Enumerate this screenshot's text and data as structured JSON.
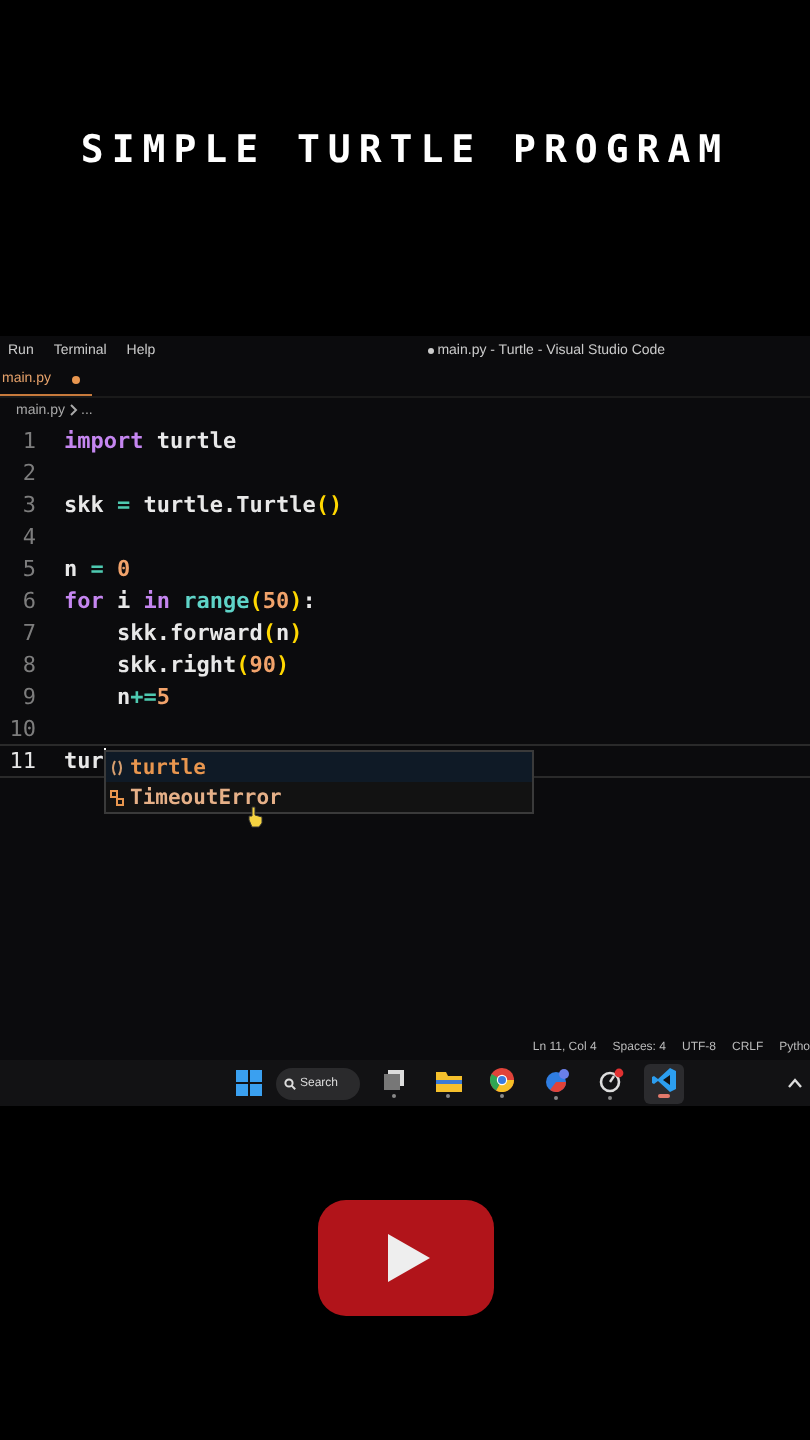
{
  "heading": "SIMPLE TURTLE PROGRAM",
  "window": {
    "menu": [
      "Run",
      "Terminal",
      "Help"
    ],
    "title": "main.py - Turtle - Visual Studio Code",
    "modified": true
  },
  "tabs": [
    {
      "label": "main.py",
      "selected": true,
      "modified": true
    }
  ],
  "breadcrumbs": [
    "main.py",
    "..."
  ],
  "editor": {
    "lines": [
      {
        "number": "1",
        "current": false,
        "tokens": [
          {
            "text": "import",
            "kind": "keyword"
          },
          {
            "text": " turtle",
            "kind": "plain"
          }
        ]
      },
      {
        "number": "2",
        "current": false
      },
      {
        "number": "3",
        "current": false,
        "tokens": [
          {
            "text": "skk ",
            "kind": "plain"
          },
          {
            "text": "=",
            "kind": "operator"
          },
          {
            "text": " turtle.Turtle",
            "kind": "plain"
          },
          {
            "text": "()",
            "kind": "paren"
          }
        ]
      },
      {
        "number": "4",
        "current": false
      },
      {
        "number": "5",
        "current": false,
        "tokens": [
          {
            "text": "n ",
            "kind": "plain"
          },
          {
            "text": "=",
            "kind": "operator"
          },
          {
            "text": " 0",
            "kind": "number"
          }
        ]
      },
      {
        "number": "6",
        "current": false,
        "tokens": [
          {
            "text": "for",
            "kind": "keyword"
          },
          {
            "text": " i ",
            "kind": "plain"
          },
          {
            "text": "in ",
            "kind": "keyword"
          },
          {
            "text": "range",
            "kind": "function"
          },
          {
            "text": "(",
            "kind": "paren"
          },
          {
            "text": "50",
            "kind": "number"
          },
          {
            "text": ")",
            "kind": "paren"
          },
          {
            "text": ":",
            "kind": "plain"
          }
        ]
      },
      {
        "number": "7",
        "current": false,
        "tokens": [
          {
            "text": "    skk.forward",
            "kind": "plain"
          },
          {
            "text": "(",
            "kind": "paren"
          },
          {
            "text": "n",
            "kind": "plain"
          },
          {
            "text": ")",
            "kind": "paren"
          }
        ]
      },
      {
        "number": "8",
        "current": false,
        "tokens": [
          {
            "text": "    skk.right",
            "kind": "plain"
          },
          {
            "text": "(",
            "kind": "paren"
          },
          {
            "text": "90",
            "kind": "number"
          },
          {
            "text": ")",
            "kind": "paren"
          }
        ]
      },
      {
        "number": "9",
        "current": false,
        "tokens": [
          {
            "text": "    n",
            "kind": "plain"
          },
          {
            "text": "+=",
            "kind": "operator"
          },
          {
            "text": "5",
            "kind": "number"
          }
        ]
      },
      {
        "number": "10",
        "current": false
      },
      {
        "number": "11",
        "current": true,
        "tokens": [
          {
            "text": "tur",
            "kind": "plain"
          }
        ]
      }
    ],
    "suggestions": [
      {
        "kind": "module",
        "label": "turtle",
        "selected": true
      },
      {
        "kind": "class",
        "label": "TimeoutError",
        "selected": false
      }
    ]
  },
  "status_bar": [
    "Ln 11, Col 4",
    "Spaces: 4",
    "UTF-8",
    "CRLF",
    "Pytho"
  ],
  "taskbar": {
    "search": "Search",
    "apps": [
      {
        "kind": "taskview",
        "active": false
      },
      {
        "kind": "folder",
        "active": false
      },
      {
        "kind": "browser",
        "active": false
      },
      {
        "kind": "badge",
        "active": false
      },
      {
        "kind": "dot",
        "active": false
      },
      {
        "kind": "code",
        "active": true
      }
    ]
  }
}
